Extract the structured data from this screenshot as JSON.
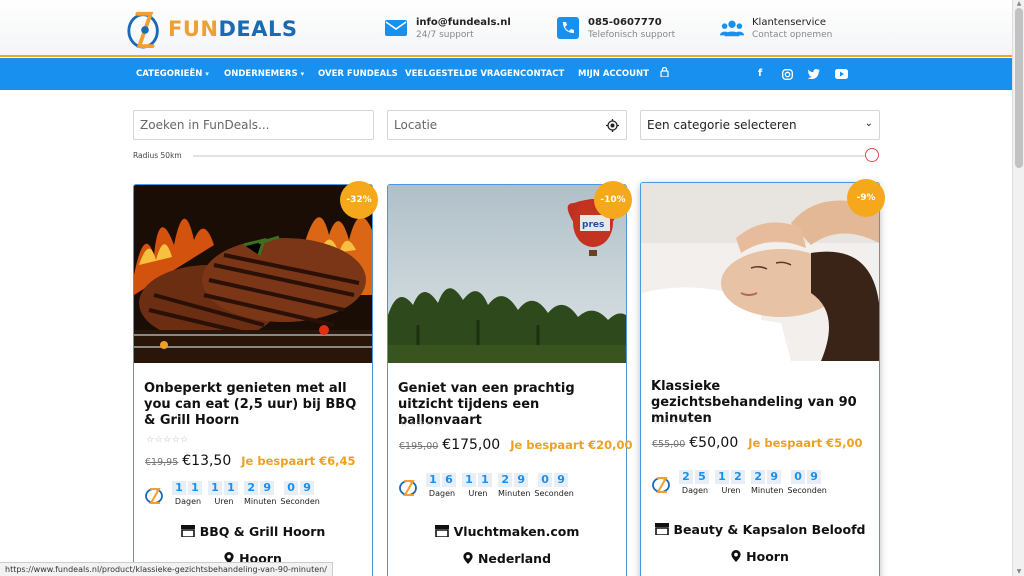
{
  "brand": {
    "part1": "FUN",
    "part2": "DEALS"
  },
  "header": {
    "email": {
      "title": "info@fundeals.nl",
      "sub": "24/7 support",
      "icon": "envelope-icon"
    },
    "phone": {
      "title": "085-0607770",
      "sub": "Telefonisch support",
      "icon": "phone-icon"
    },
    "service": {
      "title": "Klantenservice",
      "sub": "Contact opnemen",
      "icon": "users-icon"
    }
  },
  "nav": {
    "items": [
      "CATEGORIEËN",
      "ONDERNEMERS",
      "OVER FUNDEALS",
      "VEELGESTELDE VRAGEN",
      "CONTACT",
      "MIJN ACCOUNT"
    ],
    "social": [
      "facebook-icon",
      "instagram-icon",
      "twitter-icon",
      "youtube-icon"
    ]
  },
  "search": {
    "keyword_placeholder": "Zoeken in FunDeals...",
    "location_placeholder": "Locatie",
    "category_selected": "Een categorie selecteren",
    "radius_label": "Radius 50km"
  },
  "deals": [
    {
      "discount": "-32%",
      "title": "Onbeperkt genieten met all you can eat (2,5 uur) bij BBQ & Grill Hoorn",
      "stars": "☆☆☆☆☆",
      "old_price": "€19,95",
      "new_price": "€13,50",
      "saving": "Je bespaart €6,45",
      "countdown": {
        "days": [
          "1",
          "1"
        ],
        "hours": [
          "1",
          "1"
        ],
        "minutes": [
          "2",
          "9"
        ],
        "seconds": [
          "0",
          "9"
        ]
      },
      "merchant": "BBQ & Grill Hoorn",
      "location": "Hoorn"
    },
    {
      "discount": "-10%",
      "title": "Geniet van een prachtig uitzicht tijdens een ballonvaart",
      "stars": "☆☆☆☆☆",
      "old_price": "€195,00",
      "new_price": "€175,00",
      "saving": "Je bespaart €20,00",
      "countdown": {
        "days": [
          "1",
          "6"
        ],
        "hours": [
          "1",
          "1"
        ],
        "minutes": [
          "2",
          "9"
        ],
        "seconds": [
          "0",
          "9"
        ]
      },
      "merchant": "Vluchtmaken.com",
      "location": "Nederland"
    },
    {
      "discount": "-9%",
      "title": "Klassieke gezichtsbehandeling van 90 minuten",
      "stars": "☆☆☆☆☆",
      "old_price": "€55,00",
      "new_price": "€50,00",
      "saving": "Je bespaart €5,00",
      "countdown": {
        "days": [
          "2",
          "5"
        ],
        "hours": [
          "1",
          "2"
        ],
        "minutes": [
          "2",
          "9"
        ],
        "seconds": [
          "0",
          "9"
        ]
      },
      "merchant": "Beauty & Kapsalon Beloofd",
      "location": "Hoorn"
    }
  ],
  "countdown_labels": {
    "days": "Dagen",
    "hours": "Uren",
    "minutes": "Minuten",
    "seconds": "Seconden"
  },
  "status_url": "https://www.fundeals.nl/product/klassieke-gezichtsbehandeling-van-90-minuten/",
  "colors": {
    "accent": "#1890f0",
    "orange": "#f5a81c",
    "card_border": "#4a98e0"
  }
}
